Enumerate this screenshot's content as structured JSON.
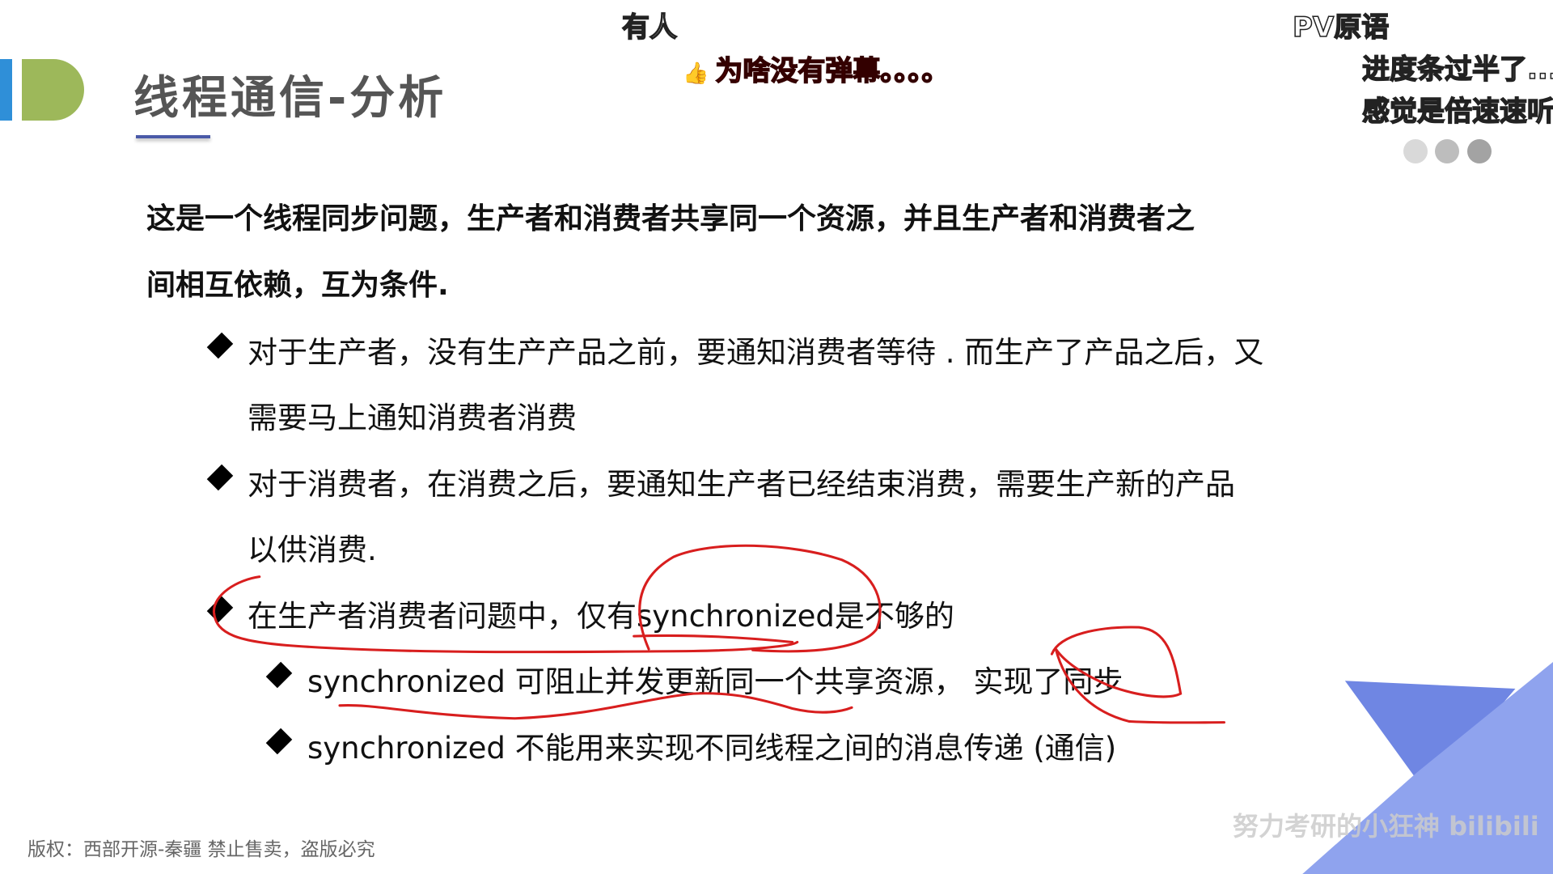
{
  "slide": {
    "title": "线程通信-分析",
    "intro_line1": "这是一个线程同步问题，生产者和消费者共享同一个资源，并且生产者和消费者之",
    "intro_line2": "间相互依赖，互为条件.",
    "bullets": [
      {
        "line1": "对于生产者，没有生产产品之前，要通知消费者等待 . 而生产了产品之后，又",
        "line2": "需要马上通知消费者消费"
      },
      {
        "line1": "对于消费者，在消费之后，要通知生产者已经结束消费，需要生产新的产品",
        "line2": "以供消费."
      },
      {
        "line1": "在生产者消费者问题中，仅有synchronized是不够的"
      }
    ],
    "sub_bullets": [
      "synchronized 可阻止并发更新同一个共享资源， 实现了同步",
      "synchronized 不能用来实现不同线程之间的消息传递 (通信)"
    ],
    "footer": "版权：西部开源-秦疆    禁止售卖，盗版必究"
  },
  "danmaku": [
    "有人",
    "为啥没有弹幕。。。。",
    "PV原语",
    "进度条过半了...",
    "感觉是倍速速听"
  ],
  "watermark": "努力考研的小狂神 bilibili",
  "colors": {
    "accent_blue": "#2f8fd8",
    "accent_green": "#9db85a",
    "annotation": "#d81e1e",
    "danmaku_highlight": "#ee0000"
  }
}
